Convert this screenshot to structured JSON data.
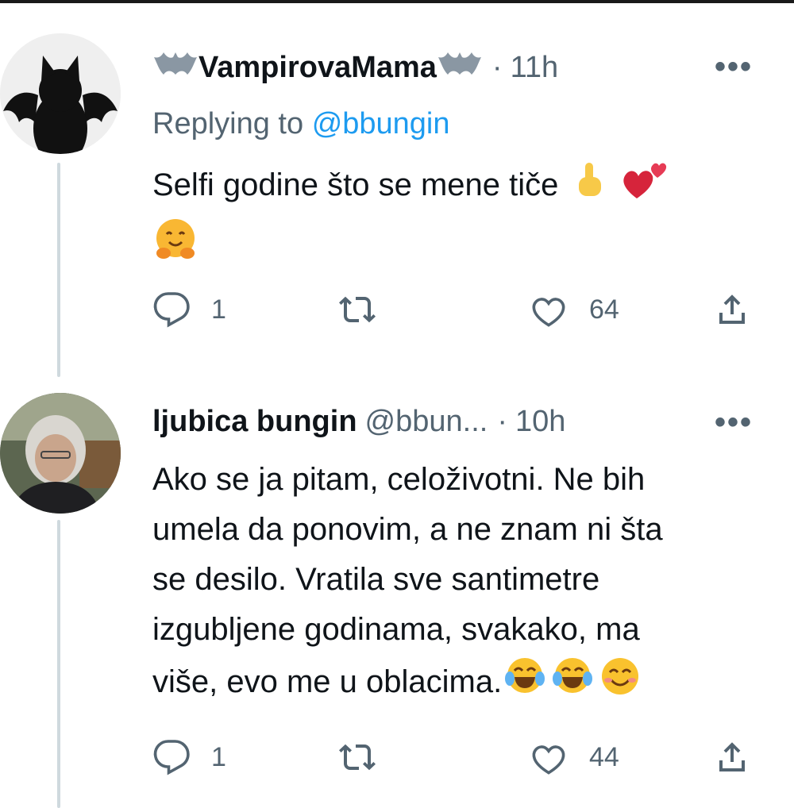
{
  "tweets": [
    {
      "display_name": "VampirovaMama",
      "name_decoration": "bat-emoji",
      "separator": "·",
      "time": "11h",
      "more_label": "•••",
      "replying_prefix": "Replying to",
      "replying_to": "@bbungin",
      "text": "Selfi godine što se mene tiče",
      "emojis": [
        "index-pointing-up-emoji",
        "two-hearts-emoji",
        "hugging-face-emoji"
      ],
      "reply_count": "1",
      "retweet_count": "",
      "like_count": "64",
      "avatar": "black-cat-bat-wings-avatar"
    },
    {
      "display_name": "ljubica bungin",
      "handle": "@bbun...",
      "separator": "·",
      "time": "10h",
      "more_label": "•••",
      "text_lines": [
        "Ako se ja pitam, celoživotni. Ne bih",
        "umela da ponovim, a ne znam ni šta",
        "se desilo. Vratila sve santimetre",
        "izgubljene godinama, svakako, ma",
        "više, evo me u oblacima."
      ],
      "emojis": [
        "tears-of-joy-emoji",
        "tears-of-joy-emoji",
        "smiling-face-emoji"
      ],
      "reply_count": "1",
      "retweet_count": "",
      "like_count": "44",
      "avatar": "profile-photo-avatar"
    }
  ],
  "colors": {
    "text": "#0f1419",
    "secondary": "#536471",
    "link": "#1d9bf0",
    "thread_line": "#cfd9de"
  }
}
